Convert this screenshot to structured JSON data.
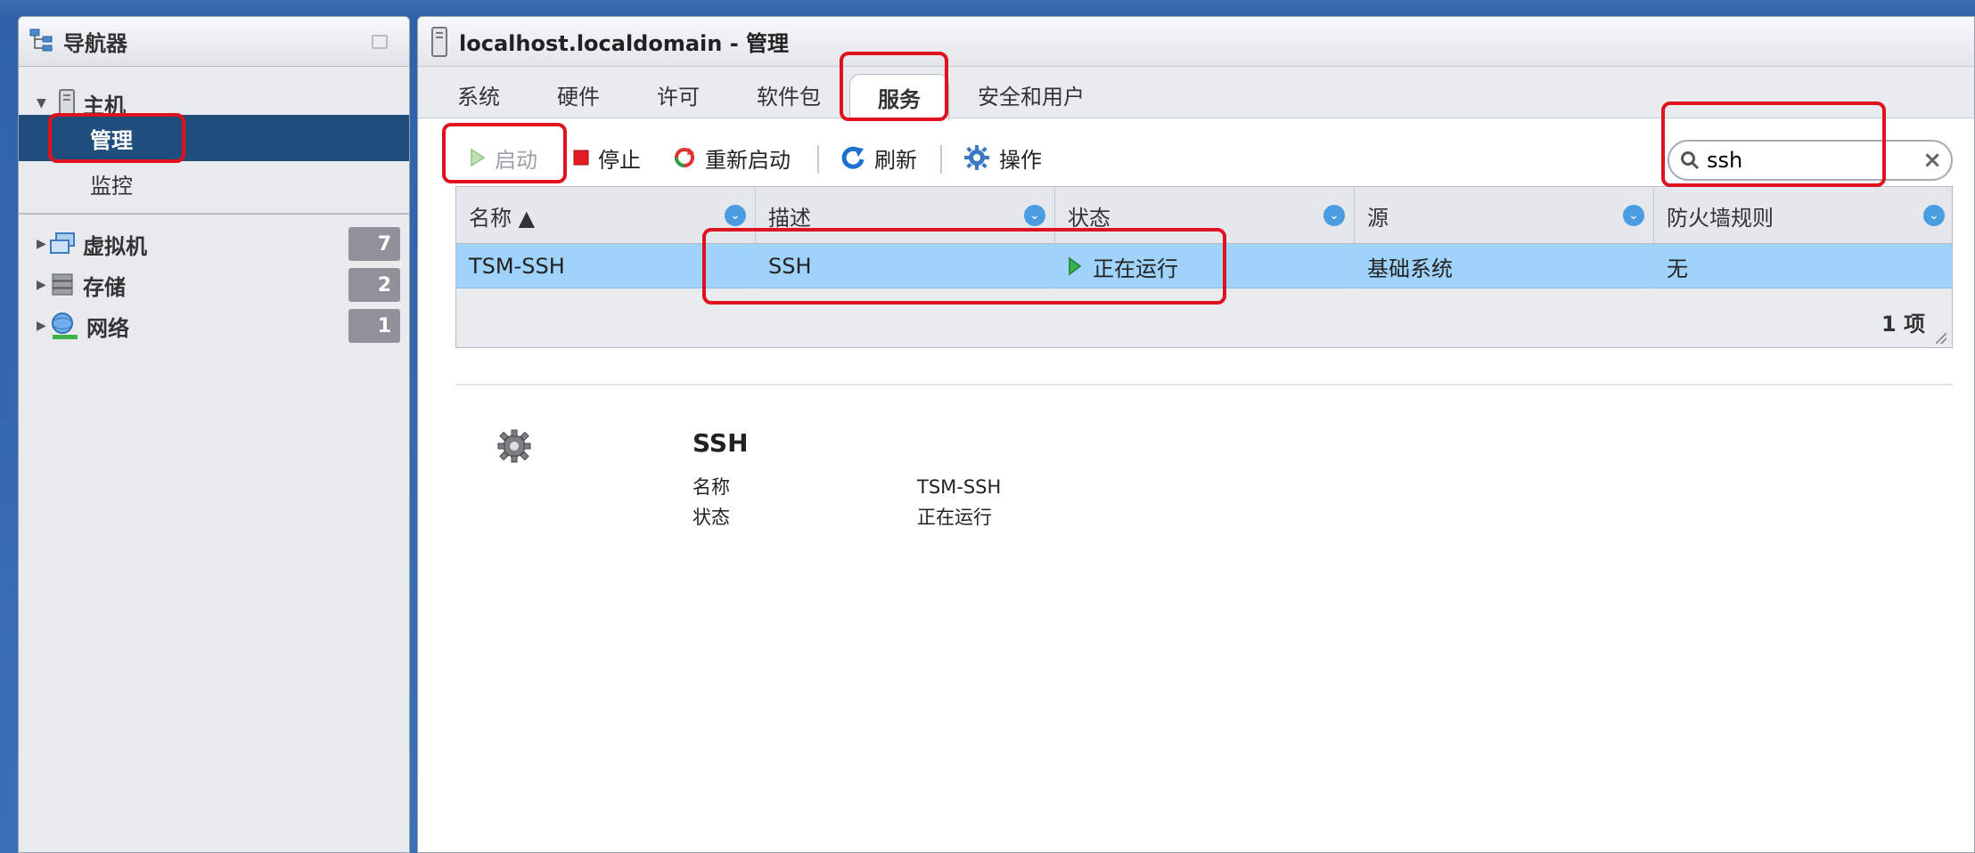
{
  "navigator": {
    "title": "导航器",
    "host": {
      "label": "主机",
      "children": [
        "管理",
        "监控"
      ]
    },
    "items": [
      {
        "label": "虚拟机",
        "count": "7"
      },
      {
        "label": "存储",
        "count": "2"
      },
      {
        "label": "网络",
        "count": "1"
      }
    ]
  },
  "main": {
    "title": "localhost.localdomain - 管理",
    "tabs": [
      "系统",
      "硬件",
      "许可",
      "软件包",
      "服务",
      "安全和用户"
    ],
    "active_tab": "服务",
    "toolbar": {
      "start": "启动",
      "stop": "停止",
      "restart": "重新启动",
      "refresh": "刷新",
      "actions": "操作"
    },
    "search": {
      "value": "ssh"
    },
    "table": {
      "columns": [
        "名称 ▲",
        "描述",
        "状态",
        "源",
        "防火墙规则"
      ],
      "rows": [
        [
          "TSM-SSH",
          "SSH",
          "正在运行",
          "基础系统",
          "无"
        ]
      ],
      "count": "1 项"
    },
    "detail": {
      "title": "SSH",
      "name_label": "名称",
      "name_value": "TSM-SSH",
      "status_label": "状态",
      "status_value": "正在运行"
    }
  },
  "colors": {
    "selected_nav": "#1f4e7d",
    "selected_row": "#9fd3fb",
    "highlight": "#e0121f"
  }
}
